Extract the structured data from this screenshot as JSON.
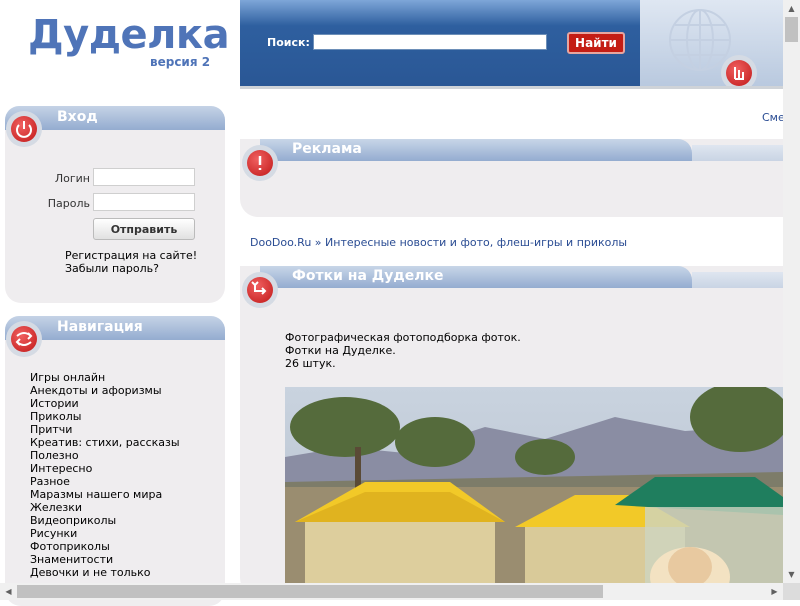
{
  "logo": {
    "title": "Дуделка",
    "version": "версия 2"
  },
  "search": {
    "label": "Поиск:",
    "placeholder": "",
    "button": "Найти"
  },
  "login": {
    "title": "Вход",
    "login_label": "Логин",
    "password_label": "Пароль",
    "submit": "Отправить",
    "register": "Регистрация на сайте!",
    "forgot": "Забыли пароль?"
  },
  "navigation": {
    "title": "Навигация",
    "items": [
      "Игры онлайн",
      "Анекдоты и афоризмы",
      "Истории",
      "Приколы",
      "Притчи",
      "Креатив: стихи, рассказы",
      "Полезно",
      "Интересно",
      "Разное",
      "Маразмы нашего мира",
      "Железки",
      "Видеоприколы",
      "Рисунки",
      "Фотоприколы",
      "Знаменитости",
      "Девочки и не только"
    ]
  },
  "top_link": "Сме",
  "ad_panel": {
    "title": "Реклама"
  },
  "breadcrumb": {
    "site": "DooDoo.Ru",
    "separator": " » ",
    "section": "Интересные новости и фото, флеш-игры и приколы"
  },
  "photos_panel": {
    "title": "Фотки на Дуделке",
    "desc_line1": "Фотографическая фотоподборка фоток.",
    "desc_line2": "Фотки на Дуделке.",
    "desc_line3": "26 штук."
  },
  "colors": {
    "brand_blue": "#4f74b8",
    "header_blue": "#2a5795",
    "accent_red": "#c41d14",
    "panel_bg": "#efedef"
  },
  "icons": {
    "login_badge": "power-icon",
    "nav_badge": "arrows-icon",
    "ad_badge": "exclamation-icon",
    "photos_badge": "swap-icon",
    "header_badge": "hand-icon",
    "globe": "globe-icon"
  }
}
